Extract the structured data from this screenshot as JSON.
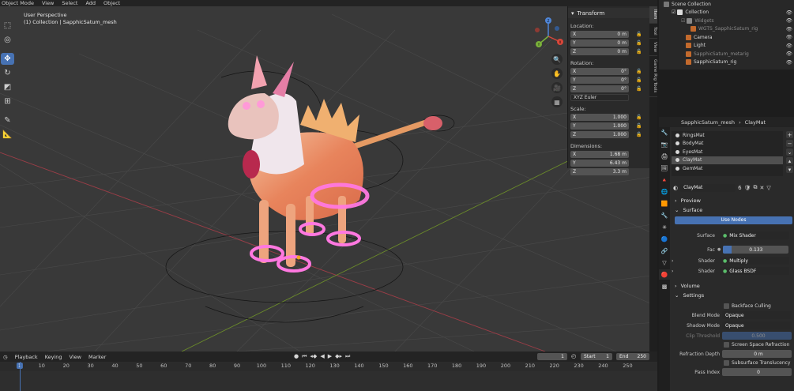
{
  "viewport_header": {
    "mode": "Object Mode",
    "menus": [
      "View",
      "Select",
      "Add",
      "Object"
    ]
  },
  "viewport_info": {
    "line1": "User Perspective",
    "line2": "(1) Collection | SapphicSatum_mesh"
  },
  "gizmo_axes": {
    "x": "X",
    "y": "Y",
    "z": "Z"
  },
  "npanel": {
    "title": "Transform",
    "location_label": "Location:",
    "location": [
      {
        "axis": "X",
        "value": "0 m"
      },
      {
        "axis": "Y",
        "value": "0 m"
      },
      {
        "axis": "Z",
        "value": "0 m"
      }
    ],
    "rotation_label": "Rotation:",
    "rotation": [
      {
        "axis": "X",
        "value": "0°"
      },
      {
        "axis": "Y",
        "value": "0°"
      },
      {
        "axis": "Z",
        "value": "0°"
      }
    ],
    "rotation_mode": "XYZ Euler",
    "scale_label": "Scale:",
    "scale": [
      {
        "axis": "X",
        "value": "1.000"
      },
      {
        "axis": "Y",
        "value": "1.000"
      },
      {
        "axis": "Z",
        "value": "1.000"
      }
    ],
    "dimensions_label": "Dimensions:",
    "dimensions": [
      {
        "axis": "X",
        "value": "1.68 m"
      },
      {
        "axis": "Y",
        "value": "6.43 m"
      },
      {
        "axis": "Z",
        "value": "3.3 m"
      }
    ]
  },
  "side_tabs": [
    "Item",
    "Tool",
    "View",
    "Game Rig Tools"
  ],
  "outliner": {
    "rows": [
      {
        "label": "Scene Collection"
      },
      {
        "label": "Collection"
      },
      {
        "label": "Widgets"
      },
      {
        "label": "WGTS_SapphicSatum_rig"
      },
      {
        "label": "Camera"
      },
      {
        "label": "Light"
      },
      {
        "label": "SapphicSatum_metarig"
      },
      {
        "label": "SapphicSatum_rig"
      }
    ]
  },
  "properties": {
    "object_name": "SapphicSatum_mesh",
    "material_name": "ClayMat",
    "materials": [
      "RingsMat",
      "BodyMat",
      "EyesMat",
      "ClayMat",
      "GemMat"
    ],
    "selected_material": "ClayMat",
    "slot_material": "ClayMat",
    "slot_users": "6",
    "sections": {
      "preview": "Preview",
      "surface": "Surface",
      "volume": "Volume",
      "settings": "Settings"
    },
    "use_nodes": "Use Nodes",
    "surface_label": "Surface",
    "surface_value": "Mix Shader",
    "fac_label": "Fac",
    "fac_value": "0.133",
    "fac_fraction": 0.133,
    "shader1_label": "Shader",
    "shader1_value": "Multiply",
    "shader2_label": "Shader",
    "shader2_value": "Glass BSDF",
    "backface": "Backface Culling",
    "blend_label": "Blend Mode",
    "blend_value": "Opaque",
    "shadow_label": "Shadow Mode",
    "shadow_value": "Opaque",
    "clip_label": "Clip Threshold",
    "clip_value": "0.500",
    "ssr": "Screen Space Refraction",
    "refr_label": "Refraction Depth",
    "refr_value": "0 m",
    "sss": "Subsurface Translucency",
    "pass_label": "Pass Index",
    "pass_value": "0"
  },
  "timeline": {
    "menus": [
      "Playback",
      "Keying",
      "View",
      "Marker"
    ],
    "current_frame": "1",
    "start_label": "Start",
    "start": "1",
    "end_label": "End",
    "end": "250",
    "ruler": [
      "1",
      "10",
      "20",
      "30",
      "40",
      "50",
      "60",
      "70",
      "80",
      "90",
      "100",
      "110",
      "120",
      "130",
      "140",
      "150",
      "160",
      "170",
      "180",
      "190",
      "200",
      "210",
      "220",
      "230",
      "240",
      "250"
    ]
  }
}
